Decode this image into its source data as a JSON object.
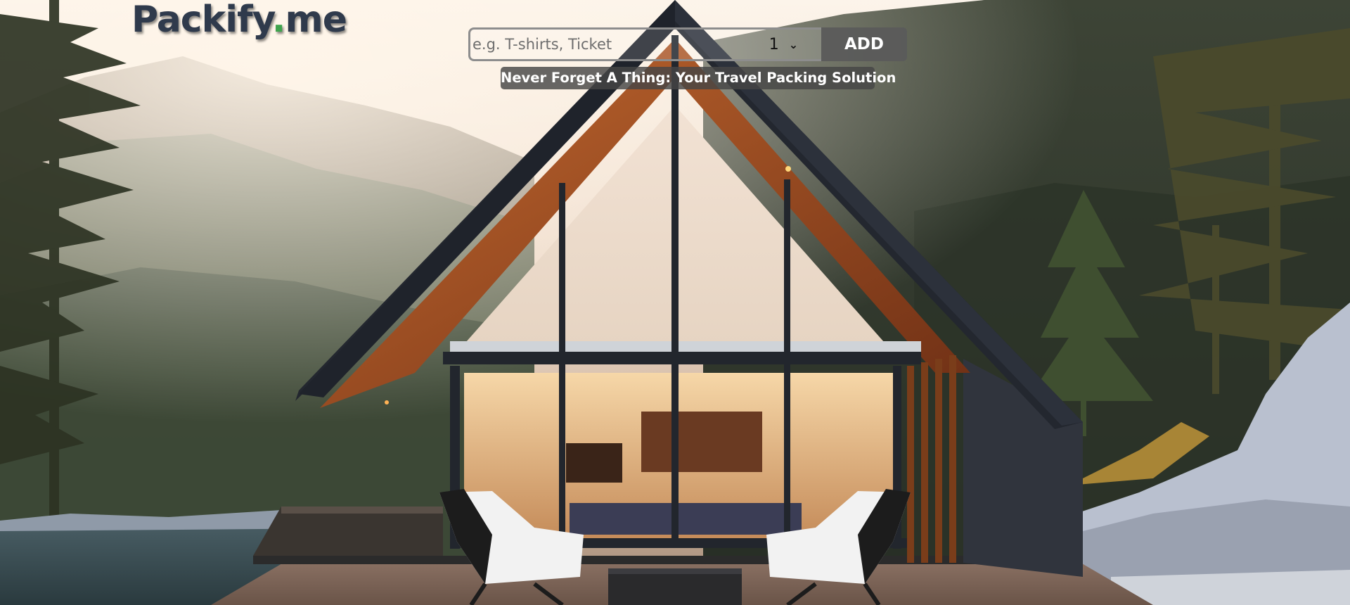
{
  "header": {
    "logo_main": "Packify",
    "logo_dot": ".",
    "logo_tld": "me"
  },
  "add_form": {
    "placeholder": "e.g. T-shirts, Ticket",
    "item_value": "",
    "quantity_selected": "1",
    "add_label": "ADD"
  },
  "tagline": "Never Forget A Thing: Your Travel Packing Solution",
  "background": {
    "image": "a-frame-cabin-in-forest",
    "sky_color": "#f3e7dc",
    "roof_color": "#2a2f38",
    "wood_color": "#b65a2a",
    "glow_color": "#f6c98a"
  },
  "icons": {
    "select_caret": "chevron-down-icon"
  }
}
